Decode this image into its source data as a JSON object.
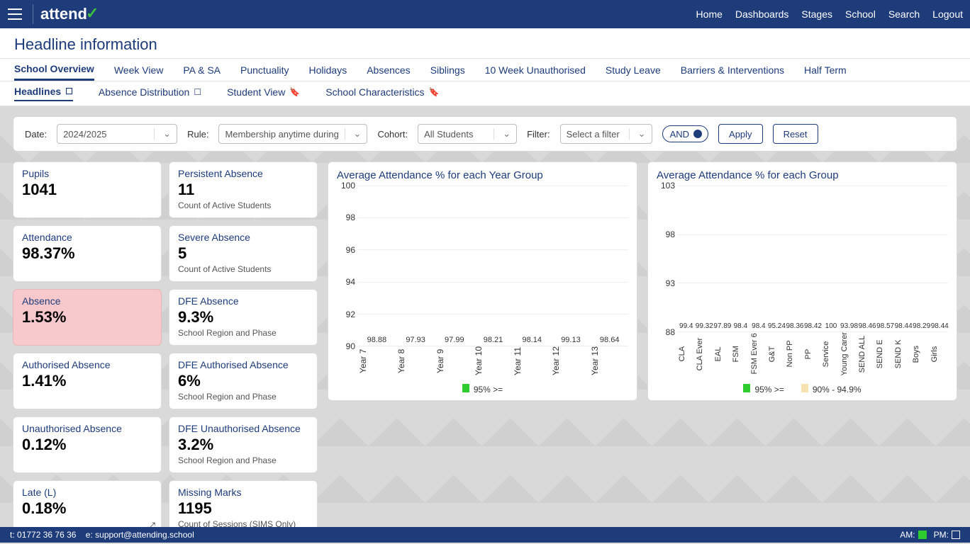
{
  "brand": "attend",
  "topnav": [
    "Home",
    "Dashboards",
    "Stages",
    "School",
    "Search",
    "Logout"
  ],
  "page_title": "Headline information",
  "tabs": [
    "School Overview",
    "Week View",
    "PA & SA",
    "Punctuality",
    "Holidays",
    "Absences",
    "Siblings",
    "10 Week Unauthorised",
    "Study Leave",
    "Barriers & Interventions",
    "Half Term"
  ],
  "active_tab": 0,
  "subtabs": [
    {
      "label": "Headlines",
      "mark": "☐",
      "active": true
    },
    {
      "label": "Absence Distribution",
      "mark": "☐"
    },
    {
      "label": "Student View",
      "mark": "🔖"
    },
    {
      "label": "School Characteristics",
      "mark": "🔖"
    }
  ],
  "filters": {
    "date_label": "Date:",
    "date_value": "2024/2025",
    "rule_label": "Rule:",
    "rule_value": "Membership anytime during",
    "cohort_label": "Cohort:",
    "cohort_value": "All Students",
    "filter_label": "Filter:",
    "filter_value": "Select a filter",
    "and_label": "AND",
    "apply": "Apply",
    "reset": "Reset"
  },
  "kpis": [
    {
      "title": "Pupils",
      "value": "1041"
    },
    {
      "title": "Persistent Absence",
      "value": "11",
      "sub": "Count of Active Students"
    },
    {
      "title": "Attendance",
      "value": "98.37%"
    },
    {
      "title": "Severe Absence",
      "value": "5",
      "sub": "Count of Active Students"
    },
    {
      "title": "Absence",
      "value": "1.53%",
      "pink": true
    },
    {
      "title": "DFE Absence",
      "value": "9.3%",
      "sub": "School Region and Phase"
    },
    {
      "title": "Authorised Absence",
      "value": "1.41%"
    },
    {
      "title": "DFE Authorised Absence",
      "value": "6%",
      "sub": "School Region and Phase"
    },
    {
      "title": "Unauthorised Absence",
      "value": "0.12%"
    },
    {
      "title": "DFE Unauthorised Absence",
      "value": "3.2%",
      "sub": "School Region and Phase"
    },
    {
      "title": "Late (L)",
      "value": "0.18%",
      "ext": true
    },
    {
      "title": "Missing Marks",
      "value": "1195",
      "sub": "Count of Sessions (SIMS Only)"
    }
  ],
  "chart_data": [
    {
      "type": "bar",
      "title": "Average Attendance % for each Year Group",
      "ylim": [
        90,
        100
      ],
      "yticks": [
        90,
        92,
        94,
        96,
        98,
        100
      ],
      "categories": [
        "Year 7",
        "Year 8",
        "Year 9",
        "Year 10",
        "Year 11",
        "Year 12",
        "Year 13"
      ],
      "values": [
        98.88,
        97.93,
        97.99,
        98.21,
        98.14,
        99.13,
        98.64
      ],
      "thresholds": [
        {
          "label": "95% >=",
          "color": "green"
        }
      ]
    },
    {
      "type": "bar",
      "title": "Average Attendance % for each Group",
      "ylim": [
        88,
        103
      ],
      "yticks": [
        88,
        93,
        98,
        103
      ],
      "categories": [
        "CLA",
        "CLA Ever",
        "EAL",
        "FSM",
        "FSM Ever 6",
        "G&T",
        "Non PP",
        "PP",
        "Service",
        "Young Carer",
        "SEND ALL",
        "SEND E",
        "SEND K",
        "Boys",
        "Girls"
      ],
      "values": [
        99.4,
        99.32,
        97.89,
        98.4,
        98.4,
        95.24,
        98.36,
        98.42,
        100,
        93.98,
        98.46,
        98.57,
        98.44,
        98.29,
        98.44
      ],
      "thresholds": [
        {
          "label": "95% >=",
          "color": "green"
        },
        {
          "label": "90% - 94.9%",
          "color": "orange"
        }
      ]
    }
  ],
  "footer": {
    "tel_label": "t:",
    "tel": "01772 36 76 36",
    "email_label": "e:",
    "email": "support@attending.school",
    "am": "AM:",
    "pm": "PM:"
  }
}
